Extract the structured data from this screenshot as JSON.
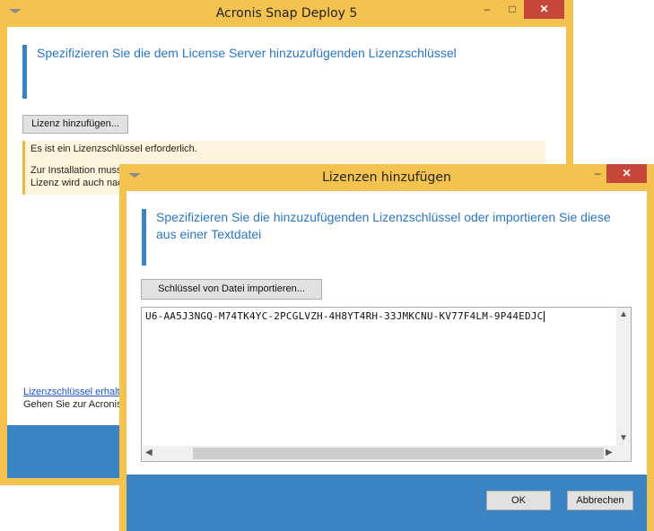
{
  "main_window": {
    "title": "Acronis Snap Deploy 5",
    "minimize": "–",
    "maximize": "□",
    "close": "✕",
    "heading": "Spezifizieren Sie die dem License Server hinzuzufügenden Lizenzschlüssel",
    "add_license_button": "Lizenz hinzufügen...",
    "warning_line1": "Es ist ein Lizenzschlüssel erforderlich.",
    "warning_line2": "Zur Installation muss",
    "warning_line3": "Lizenz wird auch nac",
    "get_key_link": "Lizenzschlüssel erhalte",
    "goto_text": "Gehen Sie zur Acronis-"
  },
  "dialog": {
    "title": "Lizenzen hinzufügen",
    "minimize": "–",
    "close": "✕",
    "heading": "Spezifizieren Sie die hinzuzufügenden Lizenzschlüssel oder importieren Sie diese aus einer Textdatei",
    "import_button": "Schlüssel von Datei importieren...",
    "license_key_value": "U6-AA5J3NGQ-M74TK4YC-2PCGLVZH-4H8YT4RH-33JMKCNU-KV77F4LM-9P44EDJC",
    "ok_button": "OK",
    "cancel_button": "Abbrechen"
  },
  "colors": {
    "frame": "#f4c24e",
    "accent": "#3a84c4",
    "close_button": "#c7463a",
    "warning_bg": "#fff5dc"
  }
}
